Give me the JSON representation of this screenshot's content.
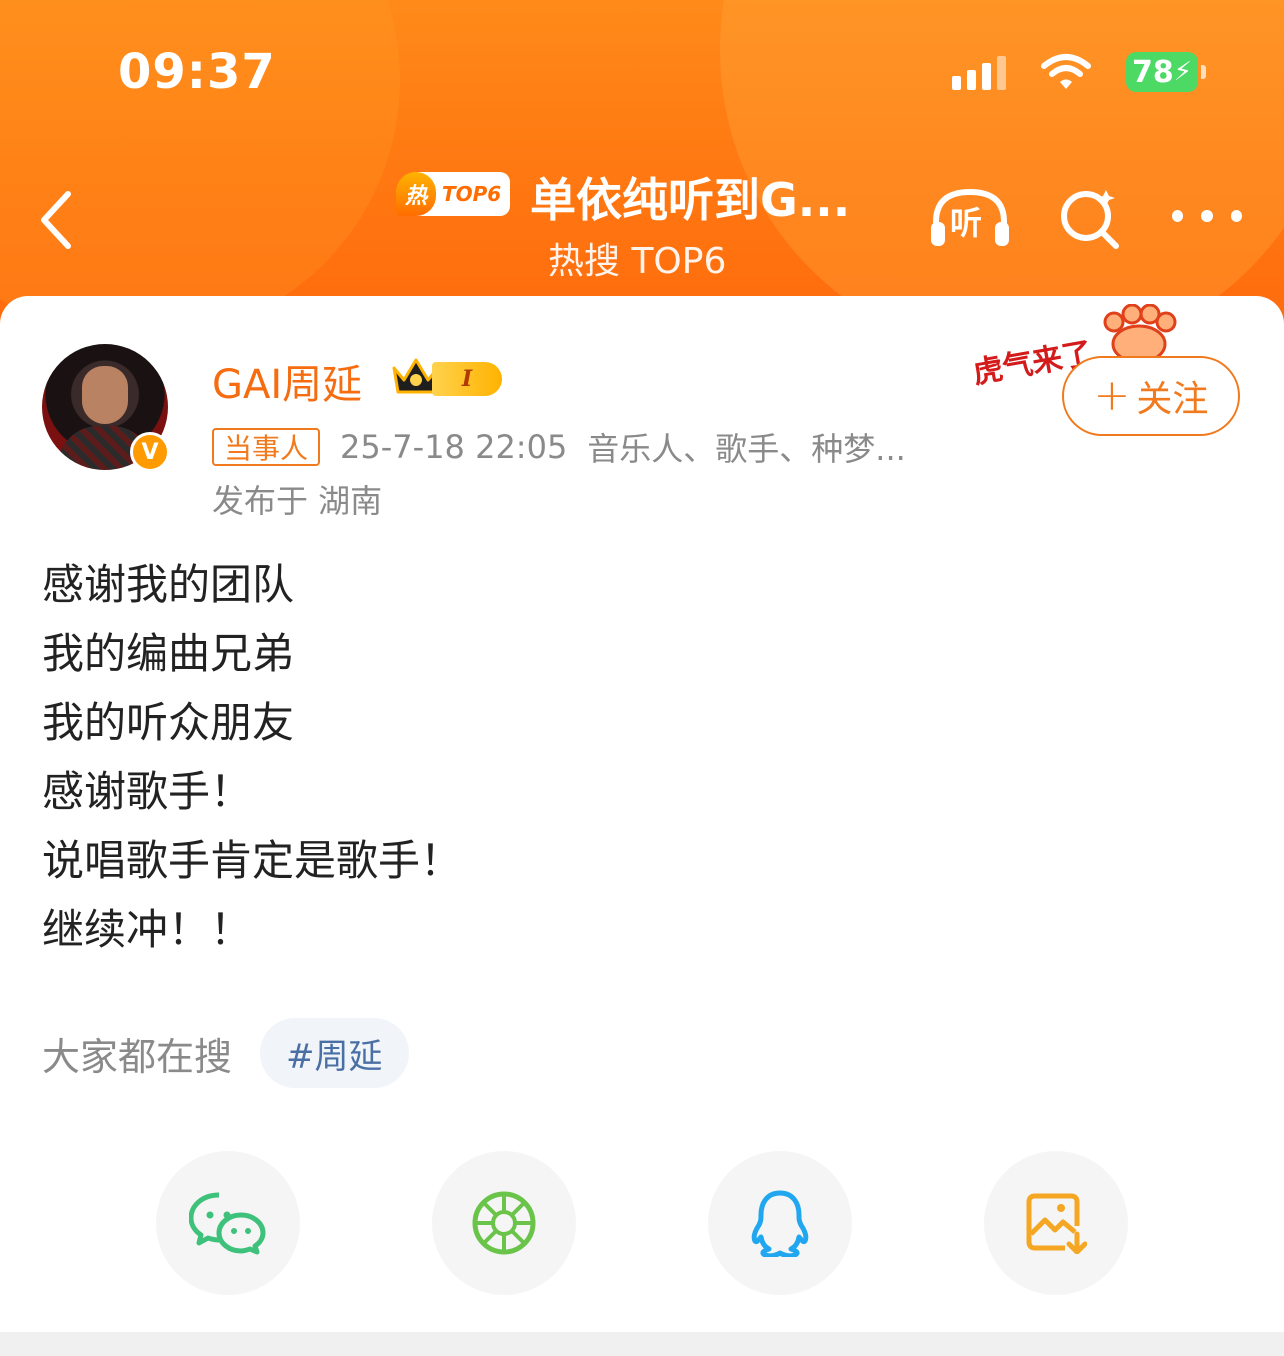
{
  "status_bar": {
    "time": "09:37",
    "battery": "78"
  },
  "nav": {
    "hot_badge_icon": "热",
    "hot_badge_rank": "TOP6",
    "title": "单依纯听到G...",
    "subtitle": "热搜 TOP6",
    "listen_label": "听"
  },
  "post": {
    "username": "GAI周延",
    "level": "I",
    "verified_mark": "V",
    "party_tag": "当事人",
    "time": "25-7-18 22:05",
    "description": "音乐人、歌手、种梦...",
    "location": "发布于 湖南",
    "sticker_text": "虎气来了",
    "follow_label": "关注",
    "follow_plus": "+",
    "lines": [
      "感谢我的团队",
      "我的编曲兄弟",
      "我的听众朋友",
      "感谢歌手！",
      "说唱歌手肯定是歌手！",
      "继续冲！！"
    ]
  },
  "search": {
    "label": "大家都在搜",
    "chip": "#周延"
  },
  "share": {
    "items": [
      "wechat-icon",
      "moments-icon",
      "qq-icon",
      "save-image-icon"
    ]
  },
  "colors": {
    "header_orange": "#ff7a12",
    "accent_orange": "#f07a1d",
    "wechat_green": "#3ec17a",
    "moments_green": "#6ac44a",
    "qq_blue": "#21a7f0",
    "save_orange": "#f5a623"
  }
}
